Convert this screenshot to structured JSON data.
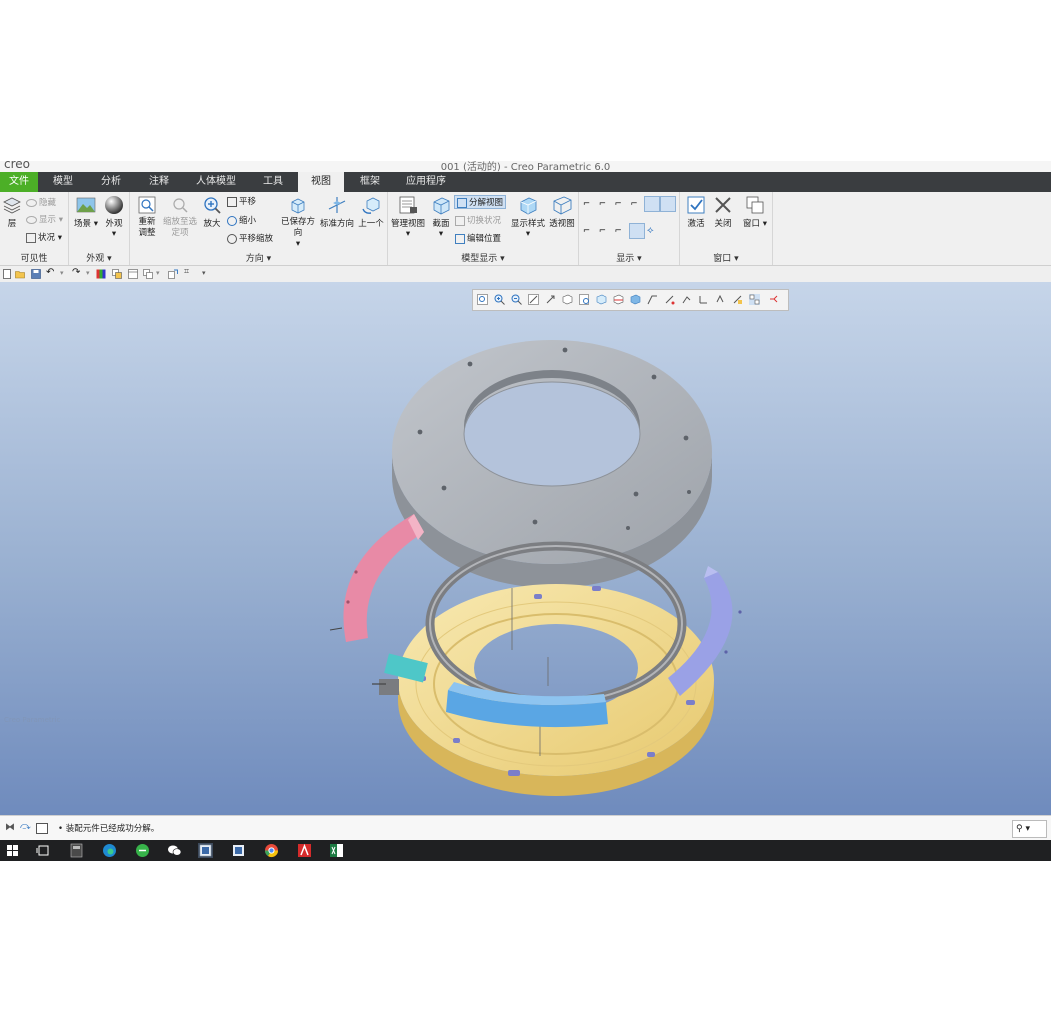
{
  "window": {
    "title": "001 (活动的) - Creo Parametric 6.0",
    "logo": "creo"
  },
  "tabs": [
    {
      "label": "文件"
    },
    {
      "label": "模型"
    },
    {
      "label": "分析"
    },
    {
      "label": "注释"
    },
    {
      "label": "人体模型"
    },
    {
      "label": "工具"
    },
    {
      "label": "视图"
    },
    {
      "label": "框架"
    },
    {
      "label": "应用程序"
    }
  ],
  "active_tab": "视图",
  "ribbon": {
    "visibility": {
      "layer": "层",
      "hide": "隐藏",
      "show": "显示",
      "status": "状况",
      "group": "可见性"
    },
    "appearance": {
      "scene": "场景",
      "appearance": "外观",
      "group": "外观"
    },
    "orientation": {
      "refit": "重新调整",
      "zoom_to_selected": "缩放至选定项",
      "zoom_in": "放大",
      "pan": "平移",
      "zoom_out": "缩小",
      "pan_zoom": "平移缩放",
      "saved_orientations": "已保存方向",
      "standard_orientation": "标准方向",
      "previous": "上一个",
      "group": "方向"
    },
    "model_display": {
      "manage_views": "管理视图",
      "section": "截面",
      "explode_view": "分解视图",
      "toggle_status": "切换状况",
      "edit_position": "编辑位置",
      "display_style": "显示样式",
      "perspective": "透视图",
      "group": "模型显示"
    },
    "show": {
      "group": "显示"
    },
    "window": {
      "activate": "激活",
      "close": "关闭",
      "windows": "窗口",
      "group": "窗口"
    }
  },
  "status_message": "装配元件已经成功分解。",
  "viewport_note": "Creo Parametric",
  "colors": {
    "file_tab": "#4caf27",
    "tab_strip": "#3a3d40",
    "plate": "#a8acb2",
    "ring_yellow": "#f3dc95",
    "seg_pink": "#e88aa6",
    "seg_purple": "#9aa1e6",
    "seg_blue": "#5aa6e4",
    "block_cyan": "#4ec7c8"
  },
  "icons": [
    "layer-icon",
    "scene-icon",
    "appearance-icon",
    "refit-icon",
    "zoom-in-icon",
    "orientation-icon",
    "explode-icon",
    "activate-icon",
    "close-icon",
    "windows-icon"
  ]
}
